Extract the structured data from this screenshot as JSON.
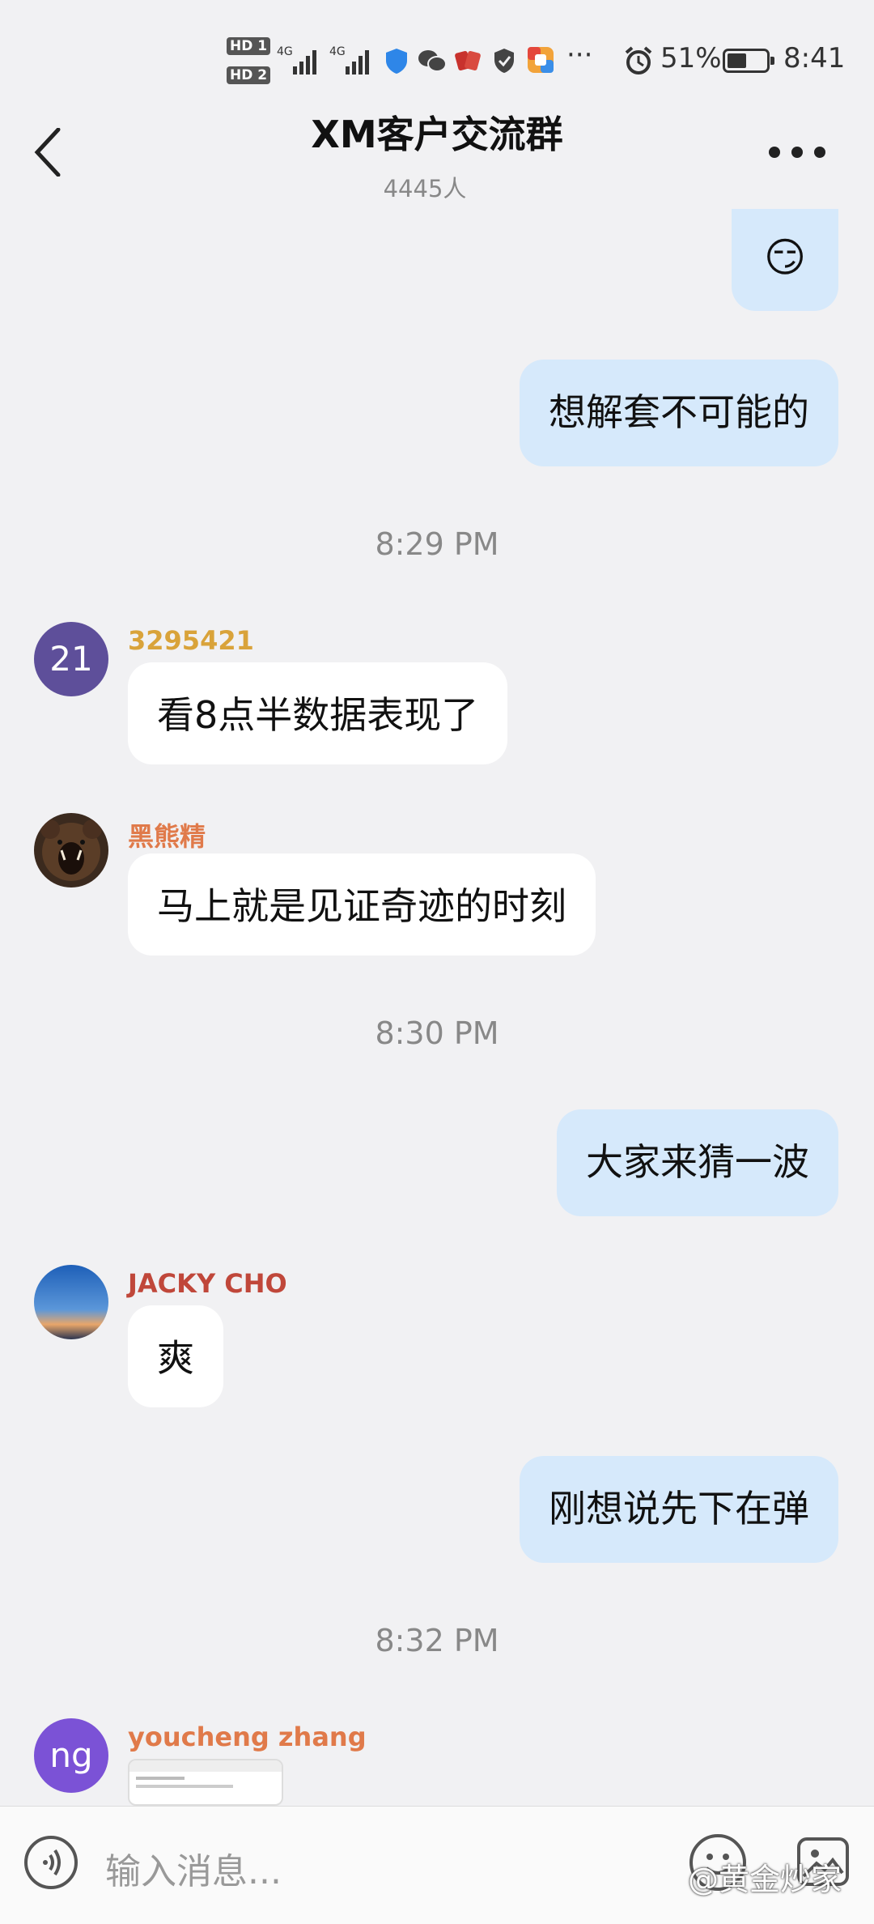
{
  "status_bar": {
    "hd1": "HD 1",
    "hd2": "HD 2",
    "net1": "4G",
    "net2": "4G",
    "more_icons": "···",
    "battery_percent": "51%",
    "battery_level": 0.51,
    "time": "8:41"
  },
  "header": {
    "title": "XM客户交流群",
    "member_count": "4445人"
  },
  "messages": [
    {
      "side": "out",
      "text": "😏"
    },
    {
      "side": "out",
      "text": "想解套不可能的"
    },
    {
      "time": "8:29 PM"
    },
    {
      "side": "in",
      "avatar_text": "21",
      "avatar_color": "#5e4f9a",
      "sender": "3295421",
      "sender_color": "#d9a33a",
      "text": "看8点半数据表现了"
    },
    {
      "side": "in",
      "avatar_icon": "bear-avatar",
      "sender": "黑熊精",
      "sender_color": "#e07a4a",
      "text": "马上就是见证奇迹的时刻"
    },
    {
      "time": "8:30 PM"
    },
    {
      "side": "out",
      "text": "大家来猜一波"
    },
    {
      "side": "in",
      "avatar_icon": "sky-avatar",
      "sender": "JACKY CHO",
      "sender_color": "#c0473a",
      "text": "爽"
    },
    {
      "side": "out",
      "text": "刚想说先下在弹"
    },
    {
      "time": "8:32 PM"
    },
    {
      "side": "in",
      "avatar_text": "ng",
      "avatar_color": "#7b52d6",
      "sender": "youcheng zhang",
      "sender_color": "#e07a4a",
      "image": "screenshot-thumbnail"
    }
  ],
  "input": {
    "placeholder": "输入消息..."
  },
  "watermark": "@黄金炒家",
  "colors": {
    "outgoing_bubble": "#d6e9fb",
    "incoming_bubble": "#ffffff",
    "background": "#f1f1f3"
  }
}
